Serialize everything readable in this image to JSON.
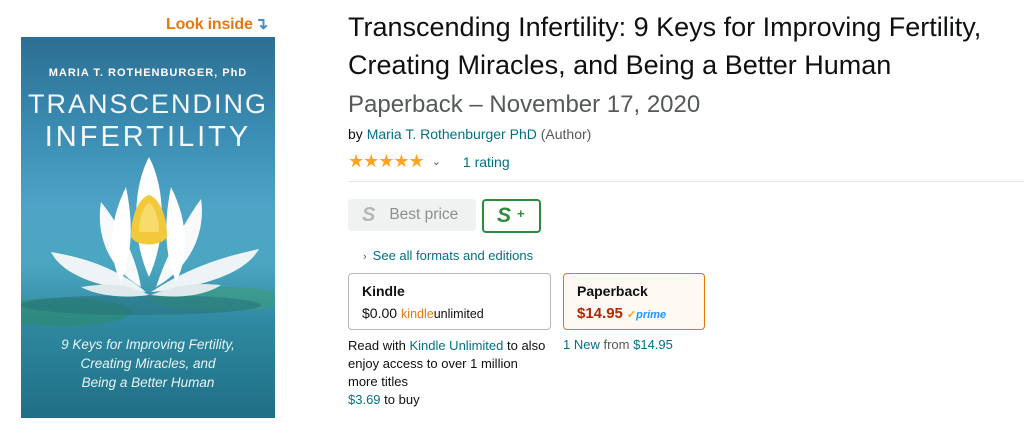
{
  "look_inside": {
    "label": "Look inside",
    "arrow": "↴"
  },
  "cover": {
    "author": "MARIA T. ROTHENBURGER, PhD",
    "title_line1": "TRANSCENDING",
    "title_line2": "INFERTILITY",
    "subtitle_lines": [
      "9 Keys for Improving Fertility,",
      "Creating Miracles, and",
      "Being a Better Human"
    ]
  },
  "product": {
    "title": "Transcending Infertility: 9 Keys for Improving Fertility, Creating Miracles, and Being a Better Human",
    "format_date": "Paperback – November 17, 2020",
    "by": "by",
    "author": "Maria T. Rothenburger PhD",
    "author_role": "(Author)",
    "stars": "★★★★★",
    "chevron": "⌄",
    "rating_count": "1 rating"
  },
  "badges": {
    "best_price_icon": "S",
    "best_price_label": "Best price",
    "splus_icon": "S",
    "splus_plus": "+"
  },
  "formats_link": {
    "chevron": "›",
    "label": "See all formats and editions"
  },
  "kindle": {
    "name": "Kindle",
    "price": "$0.00",
    "ku_brand_1": "kindle",
    "ku_brand_2": "unlimited",
    "read_with": "Read with",
    "ku_link": "Kindle Unlimited",
    "ku_rest": "to also enjoy access to over 1 million more titles",
    "buy_price": "$3.69",
    "buy_text": "to buy"
  },
  "paperback": {
    "name": "Paperback",
    "price": "$14.95",
    "prime_check": "✓",
    "prime_label": "prime",
    "new_link": "1 New",
    "from_text": "from",
    "from_price": "$14.95"
  },
  "colors": {
    "link": "#007185",
    "price": "#b12704",
    "star": "#ffa41c",
    "accent": "#e47911"
  }
}
